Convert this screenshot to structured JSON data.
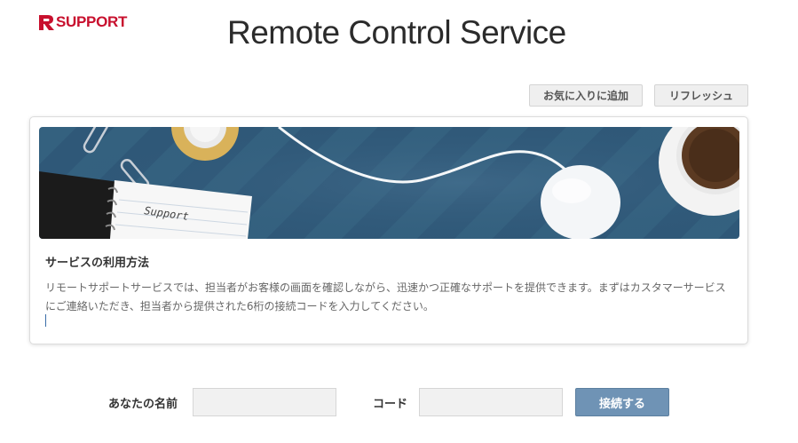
{
  "brand": {
    "logo_text": "SUPPORT",
    "logo_color": "#c8102e"
  },
  "header": {
    "title": "Remote Control Service"
  },
  "toolbar": {
    "favorite_label": "お気に入りに追加",
    "refresh_label": "リフレッシュ"
  },
  "banner": {
    "notebook_text": "Support",
    "background_color": "#2d5677"
  },
  "info": {
    "title": "サービスの利用方法",
    "description_line1": "リモートサポートサービスでは、担当者がお客様の画面を確認しながら、迅速かつ正確なサポートを提供できます。まずはカスタマーサービス",
    "description_line2": "にご連絡いただき、担当者から提供された6桁の接続コードを入力してください。"
  },
  "form": {
    "name_label": "あなたの名前",
    "name_value": "",
    "code_label": "コード",
    "code_value": "",
    "connect_label": "接続する",
    "connect_color": "#6f93b5"
  }
}
